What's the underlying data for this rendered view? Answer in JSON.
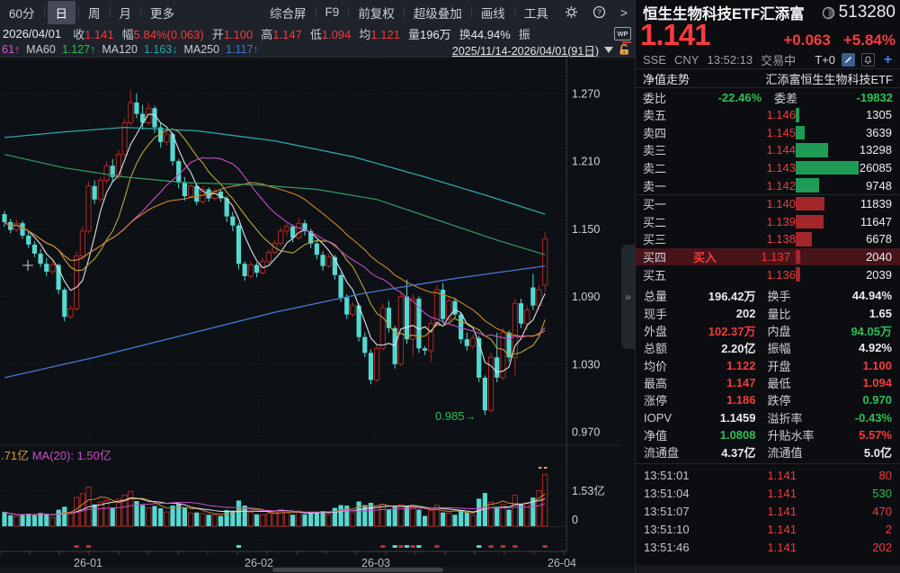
{
  "colors": {
    "up": "#f23c3e",
    "down_text": "#2fbf56",
    "candle_up": "#a92a28",
    "candle_down": "#56d8d0",
    "ask_bar": "#1e9b54",
    "bid_bar": "#a3262b",
    "accent_blue": "#3b82f6",
    "orange": "#e09a35",
    "magenta": "#c94ec9"
  },
  "toolbar": {
    "periods": [
      {
        "label": "60分",
        "active": false
      },
      {
        "label": "日",
        "active": true
      },
      {
        "label": "周",
        "active": false
      },
      {
        "label": "月",
        "active": false
      },
      {
        "label": "更多",
        "active": false
      }
    ],
    "tools": [
      "综合屏",
      "F9",
      "前复权",
      "超级叠加",
      "画线",
      "工具"
    ],
    "icons": [
      "gear",
      "help",
      "chevron-right"
    ]
  },
  "quote_bar": {
    "date": "2026/04/01",
    "fields": [
      {
        "label": "收",
        "value": "1.141",
        "c": "r"
      },
      {
        "label": "幅",
        "value": "5.84%(0.063)",
        "c": "r"
      },
      {
        "label": "开",
        "value": "1.100",
        "c": "r"
      },
      {
        "label": "高",
        "value": "1.147",
        "c": "r"
      },
      {
        "label": "低",
        "value": "1.094",
        "c": "r"
      },
      {
        "label": "均",
        "value": "1.121",
        "c": "r"
      },
      {
        "label": "量",
        "value": "196万",
        "c": "w"
      },
      {
        "label": "换",
        "value": "44.94%",
        "c": "w"
      },
      {
        "label": "振",
        "value": "",
        "c": "w"
      }
    ]
  },
  "ma_bar": {
    "items": [
      {
        "text": "61↑",
        "cls": "c-ma20"
      },
      {
        "text": "MA60",
        "cls": "lbl"
      },
      {
        "text": "1.127↑",
        "cls": "c-ma60"
      },
      {
        "text": "MA120",
        "cls": "lbl"
      },
      {
        "text": "1.163↓",
        "cls": "c-ma120"
      },
      {
        "text": "MA250",
        "cls": "lbl"
      },
      {
        "text": "1.117↑",
        "cls": "c-ma250"
      }
    ],
    "range": "2025/11/14-2026/04/01(91日)"
  },
  "chart": {
    "price_ticks": [
      "1.270",
      "1.210",
      "1.150",
      "1.090",
      "1.030",
      "0.970"
    ],
    "vol_ticks": [
      "1.53亿",
      "0"
    ],
    "x_ticks": [
      "26-01",
      "26-02",
      "26-03",
      "26-04"
    ],
    "vol_legend_left": ".71亿",
    "vol_legend_right": "MA(20): 1.50亿",
    "annotation": "0.985→"
  },
  "chart_data": {
    "type": "candlestick",
    "security": "恒生生物科技ETF汇添富 513280",
    "period": "日K",
    "date_range": "2025/11/14-2026/04/01",
    "bars": 91,
    "price_axis": [
      1.27,
      1.21,
      1.15,
      1.09,
      1.03,
      0.97
    ],
    "volume_axis_yi": [
      1.53,
      0
    ],
    "low_annotation": 0.985,
    "candles": [
      [
        1.163,
        1.166,
        1.152,
        1.156,
        0.62
      ],
      [
        1.156,
        1.159,
        1.146,
        1.149,
        0.48
      ],
      [
        1.149,
        1.158,
        1.147,
        1.155,
        0.42
      ],
      [
        1.155,
        1.157,
        1.141,
        1.144,
        0.5
      ],
      [
        1.144,
        1.148,
        1.133,
        1.136,
        0.55
      ],
      [
        1.136,
        1.139,
        1.125,
        1.128,
        0.47
      ],
      [
        1.128,
        1.132,
        1.116,
        1.119,
        0.58
      ],
      [
        1.119,
        1.124,
        1.108,
        1.112,
        0.52
      ],
      [
        1.112,
        1.121,
        1.11,
        1.118,
        0.38
      ],
      [
        1.118,
        1.119,
        1.092,
        1.096,
        0.72
      ],
      [
        1.096,
        1.098,
        1.068,
        1.072,
        0.85
      ],
      [
        1.072,
        1.082,
        1.07,
        1.079,
        0.55
      ],
      [
        1.079,
        1.13,
        1.077,
        1.126,
        1.25
      ],
      [
        1.126,
        1.152,
        1.124,
        1.148,
        1.42
      ],
      [
        1.148,
        1.192,
        1.146,
        1.188,
        1.7
      ],
      [
        1.188,
        1.193,
        1.172,
        1.176,
        0.95
      ],
      [
        1.176,
        1.196,
        1.174,
        1.193,
        1.05
      ],
      [
        1.193,
        1.21,
        1.19,
        1.206,
        1.12
      ],
      [
        1.206,
        1.212,
        1.192,
        1.196,
        0.82
      ],
      [
        1.196,
        1.22,
        1.194,
        1.216,
        1.18
      ],
      [
        1.216,
        1.248,
        1.214,
        1.244,
        1.35
      ],
      [
        1.244,
        1.273,
        1.242,
        1.262,
        1.52
      ],
      [
        1.262,
        1.27,
        1.248,
        1.252,
        1.1
      ],
      [
        1.252,
        1.26,
        1.238,
        1.244,
        0.92
      ],
      [
        1.244,
        1.262,
        1.242,
        1.257,
        0.8
      ],
      [
        1.257,
        1.259,
        1.235,
        1.24,
        0.88
      ],
      [
        1.24,
        1.244,
        1.222,
        1.227,
        0.78
      ],
      [
        1.227,
        1.238,
        1.224,
        1.234,
        0.62
      ],
      [
        1.234,
        1.236,
        1.206,
        1.21,
        0.9
      ],
      [
        1.21,
        1.212,
        1.186,
        1.191,
        0.98
      ],
      [
        1.191,
        1.196,
        1.175,
        1.179,
        0.8
      ],
      [
        1.179,
        1.191,
        1.177,
        1.188,
        0.58
      ],
      [
        1.188,
        1.19,
        1.171,
        1.174,
        0.6
      ],
      [
        1.174,
        1.188,
        1.172,
        1.185,
        0.55
      ],
      [
        1.185,
        1.187,
        1.174,
        1.177,
        0.5
      ],
      [
        1.177,
        1.186,
        1.175,
        1.183,
        0.48
      ],
      [
        1.183,
        1.185,
        1.174,
        1.177,
        0.45
      ],
      [
        1.177,
        1.179,
        1.156,
        1.161,
        0.7
      ],
      [
        1.161,
        1.165,
        1.148,
        1.153,
        0.68
      ],
      [
        1.153,
        1.155,
        1.114,
        1.119,
        1.12
      ],
      [
        1.119,
        1.121,
        1.104,
        1.108,
        0.9
      ],
      [
        1.108,
        1.121,
        1.106,
        1.118,
        0.6
      ],
      [
        1.118,
        1.12,
        1.107,
        1.111,
        0.52
      ],
      [
        1.111,
        1.124,
        1.109,
        1.121,
        0.5
      ],
      [
        1.121,
        1.132,
        1.119,
        1.129,
        0.56
      ],
      [
        1.129,
        1.14,
        1.127,
        1.137,
        0.62
      ],
      [
        1.137,
        1.151,
        1.135,
        1.148,
        0.72
      ],
      [
        1.148,
        1.155,
        1.143,
        1.152,
        0.6
      ],
      [
        1.152,
        1.154,
        1.138,
        1.142,
        0.5
      ],
      [
        1.142,
        1.16,
        1.14,
        1.155,
        0.66
      ],
      [
        1.155,
        1.158,
        1.144,
        1.148,
        0.52
      ],
      [
        1.148,
        1.15,
        1.133,
        1.137,
        0.6
      ],
      [
        1.137,
        1.14,
        1.123,
        1.127,
        0.62
      ],
      [
        1.127,
        1.13,
        1.113,
        1.117,
        0.66
      ],
      [
        1.117,
        1.128,
        1.115,
        1.125,
        0.5
      ],
      [
        1.125,
        1.127,
        1.105,
        1.109,
        0.8
      ],
      [
        1.109,
        1.111,
        1.085,
        1.089,
        0.92
      ],
      [
        1.089,
        1.092,
        1.07,
        1.074,
        0.9
      ],
      [
        1.074,
        1.085,
        1.072,
        1.082,
        0.58
      ],
      [
        1.082,
        1.084,
        1.05,
        1.054,
        1.08
      ],
      [
        1.054,
        1.058,
        1.036,
        1.04,
        0.92
      ],
      [
        1.04,
        1.043,
        1.012,
        1.016,
        1.02
      ],
      [
        1.016,
        1.048,
        1.014,
        1.044,
        0.82
      ],
      [
        1.044,
        1.084,
        1.042,
        1.08,
        0.95
      ],
      [
        1.08,
        1.086,
        1.058,
        1.062,
        0.72
      ],
      [
        1.062,
        1.064,
        1.026,
        1.03,
        0.85
      ],
      [
        1.03,
        1.095,
        1.028,
        1.09,
        0.95
      ],
      [
        1.09,
        1.105,
        1.048,
        1.052,
        0.9
      ],
      [
        1.052,
        1.092,
        1.036,
        1.088,
        0.85
      ],
      [
        1.088,
        1.09,
        1.04,
        1.044,
        0.72
      ],
      [
        1.044,
        1.046,
        1.038,
        1.042,
        0.45
      ],
      [
        1.042,
        1.07,
        1.032,
        1.066,
        0.7
      ],
      [
        1.066,
        1.1,
        1.064,
        1.096,
        0.92
      ],
      [
        1.096,
        1.102,
        1.066,
        1.07,
        0.6
      ],
      [
        1.07,
        1.09,
        1.066,
        1.086,
        0.58
      ],
      [
        1.086,
        1.089,
        1.07,
        1.074,
        0.5
      ],
      [
        1.074,
        1.076,
        1.048,
        1.052,
        0.7
      ],
      [
        1.052,
        1.058,
        1.042,
        1.046,
        0.6
      ],
      [
        1.046,
        1.056,
        1.043,
        1.053,
        0.48
      ],
      [
        1.053,
        1.055,
        1.014,
        1.018,
        1.2
      ],
      [
        1.018,
        1.02,
        0.985,
        0.989,
        1.45
      ],
      [
        0.989,
        1.04,
        0.987,
        1.036,
        1.05
      ],
      [
        1.036,
        1.058,
        1.014,
        1.018,
        0.85
      ],
      [
        1.018,
        1.062,
        1.016,
        1.058,
        0.95
      ],
      [
        1.058,
        1.06,
        1.032,
        1.036,
        0.72
      ],
      [
        1.036,
        1.088,
        1.02,
        1.084,
        1.35
      ],
      [
        1.084,
        1.088,
        1.062,
        1.066,
        0.95
      ],
      [
        1.066,
        1.082,
        1.06,
        1.078,
        1.02
      ],
      [
        1.098,
        1.11,
        1.078,
        1.082,
        1.25
      ],
      [
        1.082,
        1.1,
        1.078,
        1.096,
        1.55
      ],
      [
        1.1,
        1.147,
        1.094,
        1.141,
        2.25
      ]
    ],
    "overlays": {
      "ma60": [
        [
          0,
          1.216
        ],
        [
          10,
          1.204
        ],
        [
          20,
          1.196
        ],
        [
          30,
          1.191
        ],
        [
          42,
          1.189
        ],
        [
          52,
          1.185
        ],
        [
          62,
          1.176
        ],
        [
          72,
          1.158
        ],
        [
          82,
          1.14
        ],
        [
          90,
          1.127
        ]
      ],
      "ma120": [
        [
          0,
          1.231
        ],
        [
          10,
          1.236
        ],
        [
          20,
          1.24
        ],
        [
          32,
          1.237
        ],
        [
          45,
          1.228
        ],
        [
          58,
          1.214
        ],
        [
          70,
          1.196
        ],
        [
          80,
          1.18
        ],
        [
          90,
          1.163
        ]
      ],
      "ma250": [
        [
          0,
          1.018
        ],
        [
          15,
          1.036
        ],
        [
          30,
          1.056
        ],
        [
          45,
          1.076
        ],
        [
          60,
          1.093
        ],
        [
          75,
          1.106
        ],
        [
          90,
          1.117
        ]
      ]
    }
  },
  "panel": {
    "name": "恒生生物科技ETF汇添富",
    "code": "513280",
    "price": "1.141",
    "change": "+0.063",
    "change_pct": "+5.84%",
    "exchange": "SSE",
    "currency": "CNY",
    "time": "13:52:13",
    "status": "交易中",
    "trade_mode": "T+0",
    "nav_tab": "净值走势",
    "fund_name": "汇添富恒生生物科技ETF",
    "weibi_label": "委比",
    "weibi": "-22.46%",
    "weicha_label": "委差",
    "weicha": "-19832",
    "sells": [
      [
        "卖五",
        "1.146",
        1305
      ],
      [
        "卖四",
        "1.145",
        3639
      ],
      [
        "卖三",
        "1.144",
        13298
      ],
      [
        "卖二",
        "1.143",
        26085
      ],
      [
        "卖一",
        "1.142",
        9748
      ]
    ],
    "buys": [
      [
        "买一",
        "1.140",
        11839
      ],
      [
        "买二",
        "1.139",
        11647
      ],
      [
        "买三",
        "1.138",
        6678
      ],
      [
        "买四",
        "1.137",
        2040
      ],
      [
        "买五",
        "1.136",
        2039
      ]
    ],
    "highlight_buy_index": 3,
    "buy_tag": "买入",
    "max_book_vol": 26085,
    "stats": [
      [
        "总量",
        "196.42万",
        "w",
        "换手",
        "44.94%",
        "w"
      ],
      [
        "现手",
        "202",
        "w",
        "量比",
        "1.65",
        "w"
      ],
      [
        "外盘",
        "102.37万",
        "r",
        "内盘",
        "94.05万",
        "g"
      ],
      [
        "总额",
        "2.20亿",
        "w",
        "振幅",
        "4.92%",
        "w"
      ],
      [
        "均价",
        "1.122",
        "r",
        "开盘",
        "1.100",
        "r"
      ],
      [
        "最高",
        "1.147",
        "r",
        "最低",
        "1.094",
        "r"
      ],
      [
        "涨停",
        "1.186",
        "r",
        "跌停",
        "0.970",
        "g"
      ],
      [
        "IOPV",
        "1.1459",
        "w",
        "溢折率",
        "-0.43%",
        "g"
      ],
      [
        "净值",
        "1.0808",
        "g",
        "升贴水率",
        "5.57%",
        "r"
      ],
      [
        "流通盘",
        "4.37亿",
        "w",
        "流通值",
        "5.0亿",
        "w"
      ]
    ],
    "trades": [
      [
        "13:51:01",
        "1.141",
        "80",
        "r"
      ],
      [
        "13:51:04",
        "1.141",
        "530",
        "g"
      ],
      [
        "13:51:07",
        "1.141",
        "470",
        "r"
      ],
      [
        "13:51:10",
        "1.141",
        "2",
        "r"
      ],
      [
        "13:51:46",
        "1.141",
        "202",
        "r"
      ]
    ],
    "expander": "»"
  }
}
